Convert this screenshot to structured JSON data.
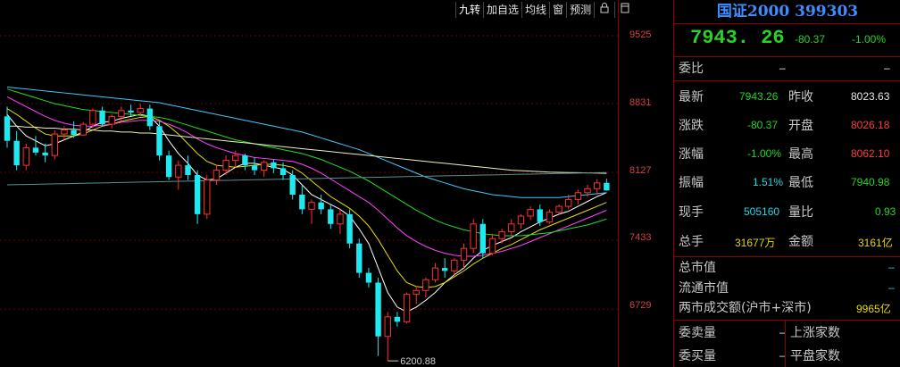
{
  "toolbar": {
    "items": [
      "九转",
      "加自选",
      "均线",
      "窗",
      "预测"
    ],
    "lock_icon": "lock-icon",
    "panel_icon": "panel-icon"
  },
  "price_axis": {
    "ticks": [
      "9525",
      "8831",
      "8127",
      "7433",
      "6729"
    ]
  },
  "chart_data": {
    "type": "candlestick",
    "low_annotation": "6200.88",
    "y_ticks": [
      9525,
      8831,
      8127,
      7433,
      6729
    ],
    "ylim": [
      6130,
      9850
    ],
    "ohlc": [
      [
        8700,
        8800,
        8380,
        8450
      ],
      [
        8450,
        8550,
        8150,
        8200
      ],
      [
        8200,
        8420,
        8150,
        8380
      ],
      [
        8380,
        8500,
        8300,
        8330
      ],
      [
        8330,
        8420,
        8230,
        8300
      ],
      [
        8300,
        8560,
        8260,
        8520
      ],
      [
        8520,
        8600,
        8460,
        8560
      ],
      [
        8560,
        8650,
        8480,
        8510
      ],
      [
        8510,
        8640,
        8500,
        8620
      ],
      [
        8620,
        8780,
        8580,
        8760
      ],
      [
        8760,
        8800,
        8600,
        8620
      ],
      [
        8620,
        8720,
        8580,
        8700
      ],
      [
        8700,
        8800,
        8650,
        8760
      ],
      [
        8760,
        8820,
        8700,
        8740
      ],
      [
        8740,
        8830,
        8700,
        8780
      ],
      [
        8780,
        8820,
        8560,
        8600
      ],
      [
        8600,
        8650,
        8250,
        8300
      ],
      [
        8300,
        8350,
        8050,
        8080
      ],
      [
        8080,
        8250,
        7950,
        8200
      ],
      [
        8200,
        8300,
        8050,
        8100
      ],
      [
        8100,
        8150,
        7600,
        7700
      ],
      [
        7700,
        8100,
        7650,
        8050
      ],
      [
        8050,
        8200,
        8000,
        8150
      ],
      [
        8150,
        8300,
        8100,
        8250
      ],
      [
        8250,
        8350,
        8180,
        8300
      ],
      [
        8300,
        8320,
        8150,
        8200
      ],
      [
        8200,
        8280,
        8100,
        8150
      ],
      [
        8150,
        8250,
        8080,
        8230
      ],
      [
        8230,
        8260,
        8120,
        8170
      ],
      [
        8170,
        8230,
        8050,
        8100
      ],
      [
        8100,
        8150,
        7850,
        7900
      ],
      [
        7900,
        8000,
        7700,
        7750
      ],
      [
        7750,
        7850,
        7600,
        7820
      ],
      [
        7820,
        7900,
        7700,
        7750
      ],
      [
        7750,
        7800,
        7550,
        7600
      ],
      [
        7600,
        7750,
        7500,
        7700
      ],
      [
        7700,
        7750,
        7350,
        7400
      ],
      [
        7400,
        7450,
        7050,
        7100
      ],
      [
        7100,
        7150,
        6950,
        7000
      ],
      [
        7000,
        7050,
        6250,
        6450
      ],
      [
        6450,
        6700,
        6200,
        6650
      ],
      [
        6650,
        6700,
        6550,
        6600
      ],
      [
        6600,
        6900,
        6580,
        6880
      ],
      [
        6880,
        6950,
        6780,
        6920
      ],
      [
        6920,
        7050,
        6850,
        7030
      ],
      [
        7030,
        7200,
        7000,
        7150
      ],
      [
        7150,
        7250,
        7050,
        7120
      ],
      [
        7120,
        7250,
        7080,
        7230
      ],
      [
        7230,
        7400,
        7150,
        7350
      ],
      [
        7350,
        7650,
        7300,
        7600
      ],
      [
        7600,
        7650,
        7250,
        7300
      ],
      [
        7300,
        7500,
        7280,
        7450
      ],
      [
        7450,
        7550,
        7400,
        7520
      ],
      [
        7520,
        7650,
        7480,
        7600
      ],
      [
        7600,
        7700,
        7550,
        7680
      ],
      [
        7680,
        7780,
        7640,
        7750
      ],
      [
        7750,
        7800,
        7580,
        7620
      ],
      [
        7620,
        7750,
        7600,
        7720
      ],
      [
        7720,
        7800,
        7700,
        7780
      ],
      [
        7780,
        7900,
        7750,
        7850
      ],
      [
        7850,
        7950,
        7800,
        7920
      ],
      [
        7920,
        8000,
        7880,
        7960
      ],
      [
        7960,
        8060,
        7900,
        8020
      ],
      [
        8020,
        8062,
        7940,
        7943
      ]
    ],
    "ma": [
      {
        "color": "#ffffff",
        "values": [
          8720,
          8600,
          8500,
          8450,
          8400,
          8420,
          8460,
          8500,
          8540,
          8600,
          8640,
          8650,
          8680,
          8700,
          8720,
          8700,
          8600,
          8450,
          8320,
          8220,
          8100,
          8050,
          8060,
          8120,
          8180,
          8220,
          8220,
          8200,
          8180,
          8160,
          8100,
          8000,
          7900,
          7850,
          7800,
          7750,
          7680,
          7550,
          7400,
          7150,
          6900,
          6750,
          6700,
          6750,
          6820,
          6900,
          7000,
          7080,
          7150,
          7250,
          7330,
          7380,
          7420,
          7460,
          7520,
          7570,
          7620,
          7660,
          7700,
          7730,
          7780,
          7830,
          7880,
          7920
        ]
      },
      {
        "color": "#e8e000",
        "values": [
          8780,
          8720,
          8650,
          8580,
          8520,
          8500,
          8500,
          8500,
          8520,
          8560,
          8600,
          8620,
          8650,
          8670,
          8690,
          8700,
          8660,
          8600,
          8520,
          8420,
          8320,
          8240,
          8200,
          8190,
          8180,
          8190,
          8200,
          8210,
          8210,
          8200,
          8180,
          8120,
          8040,
          7960,
          7880,
          7820,
          7760,
          7680,
          7580,
          7440,
          7280,
          7120,
          7000,
          6960,
          6950,
          6960,
          7000,
          7060,
          7120,
          7190,
          7250,
          7300,
          7350,
          7390,
          7440,
          7490,
          7540,
          7580,
          7620,
          7660,
          7700,
          7740,
          7780,
          7820
        ]
      },
      {
        "color": "#ff40ff",
        "values": [
          8900,
          8850,
          8800,
          8750,
          8700,
          8660,
          8630,
          8610,
          8600,
          8600,
          8610,
          8620,
          8640,
          8650,
          8660,
          8660,
          8650,
          8620,
          8580,
          8530,
          8470,
          8420,
          8380,
          8350,
          8320,
          8300,
          8280,
          8270,
          8260,
          8250,
          8240,
          8210,
          8170,
          8120,
          8060,
          8000,
          7940,
          7880,
          7820,
          7740,
          7650,
          7560,
          7480,
          7420,
          7370,
          7330,
          7300,
          7280,
          7270,
          7270,
          7280,
          7300,
          7320,
          7350,
          7380,
          7420,
          7460,
          7500,
          7540,
          7580,
          7620,
          7660,
          7700,
          7740
        ]
      },
      {
        "color": "#20e020",
        "values": [
          8980,
          8950,
          8920,
          8890,
          8860,
          8830,
          8810,
          8790,
          8770,
          8760,
          8750,
          8740,
          8730,
          8720,
          8710,
          8700,
          8690,
          8670,
          8640,
          8610,
          8580,
          8550,
          8520,
          8490,
          8460,
          8440,
          8420,
          8400,
          8380,
          8360,
          8340,
          8320,
          8290,
          8260,
          8220,
          8180,
          8140,
          8090,
          8040,
          7980,
          7920,
          7860,
          7800,
          7740,
          7690,
          7640,
          7600,
          7570,
          7540,
          7520,
          7500,
          7490,
          7480,
          7480,
          7480,
          7490,
          7500,
          7510,
          7530,
          7550,
          7570,
          7590,
          7620,
          7650
        ]
      },
      {
        "color": "#40c8ff",
        "values": [
          9000,
          8990,
          8980,
          8970,
          8960,
          8950,
          8940,
          8930,
          8920,
          8910,
          8900,
          8890,
          8880,
          8870,
          8860,
          8850,
          8840,
          8820,
          8800,
          8780,
          8760,
          8740,
          8720,
          8700,
          8680,
          8660,
          8640,
          8620,
          8600,
          8580,
          8560,
          8540,
          8510,
          8480,
          8450,
          8420,
          8390,
          8360,
          8320,
          8280,
          8240,
          8200,
          8160,
          8120,
          8080,
          8050,
          8020,
          7990,
          7960,
          7940,
          7920,
          7900,
          7890,
          7880,
          7870,
          7870,
          7870,
          7870,
          7870,
          7880,
          7890,
          7900,
          7910,
          7920
        ]
      },
      {
        "color": "#f0f0c0",
        "values": [
          8600,
          8600,
          8590,
          8590,
          8580,
          8580,
          8570,
          8570,
          8560,
          8560,
          8550,
          8550,
          8540,
          8540,
          8530,
          8530,
          8520,
          8510,
          8500,
          8490,
          8480,
          8470,
          8460,
          8450,
          8440,
          8430,
          8420,
          8410,
          8400,
          8390,
          8380,
          8370,
          8360,
          8350,
          8340,
          8330,
          8320,
          8310,
          8300,
          8290,
          8280,
          8270,
          8260,
          8250,
          8240,
          8230,
          8220,
          8210,
          8200,
          8190,
          8180,
          8170,
          8160,
          8150,
          8145,
          8140,
          8135,
          8130,
          8128,
          8126,
          8124,
          8122,
          8120,
          8118
        ]
      },
      {
        "color": "#5a9090",
        "values": [
          8000,
          8002,
          8004,
          8006,
          8008,
          8010,
          8012,
          8014,
          8016,
          8018,
          8020,
          8022,
          8024,
          8026,
          8028,
          8030,
          8032,
          8034,
          8036,
          8038,
          8040,
          8042,
          8044,
          8046,
          8048,
          8050,
          8052,
          8054,
          8056,
          8058,
          8060,
          8062,
          8064,
          8066,
          8068,
          8070,
          8072,
          8074,
          8076,
          8078,
          8080,
          8082,
          8084,
          8086,
          8088,
          8090,
          8092,
          8094,
          8096,
          8098,
          8100,
          8102,
          8104,
          8106,
          8108,
          8110,
          8112,
          8114,
          8116,
          8118,
          8120,
          8122,
          8124,
          8126
        ]
      }
    ]
  },
  "panel": {
    "title": "国证2000 399303",
    "price": "7943. 26",
    "change": "-80.37",
    "change_pct": "-1.00%",
    "rows": [
      {
        "l1": "委比",
        "v1": "–",
        "v2": "–"
      },
      {
        "l1": "最新",
        "v1": "7943.26",
        "l2": "昨收",
        "v2": "8023.63"
      },
      {
        "l1": "涨跌",
        "v1": "-80.37",
        "l2": "开盘",
        "v2": "8026.18"
      },
      {
        "l1": "涨幅",
        "v1": "-1.00%",
        "l2": "最高",
        "v2": "8062.10"
      },
      {
        "l1": "振幅",
        "v1": "1.51%",
        "l2": "最低",
        "v2": "7940.98"
      },
      {
        "l1": "现手",
        "v1": "505160",
        "l2": "量比",
        "v2": "0.93"
      },
      {
        "l1": "总手",
        "v1": "31677万",
        "l2": "金额",
        "v2": "3161亿"
      }
    ],
    "extra": [
      {
        "label": "总市值",
        "value": "–"
      },
      {
        "label": "流通市值",
        "value": "–"
      },
      {
        "label": "两市成交额(沪市+深市)",
        "value": "9965亿"
      }
    ],
    "bottom": [
      {
        "l1": "委卖量",
        "v1": "–",
        "l2": "上涨家数"
      },
      {
        "l1": "委买量",
        "v1": "–",
        "l2": "平盘家数"
      }
    ]
  }
}
